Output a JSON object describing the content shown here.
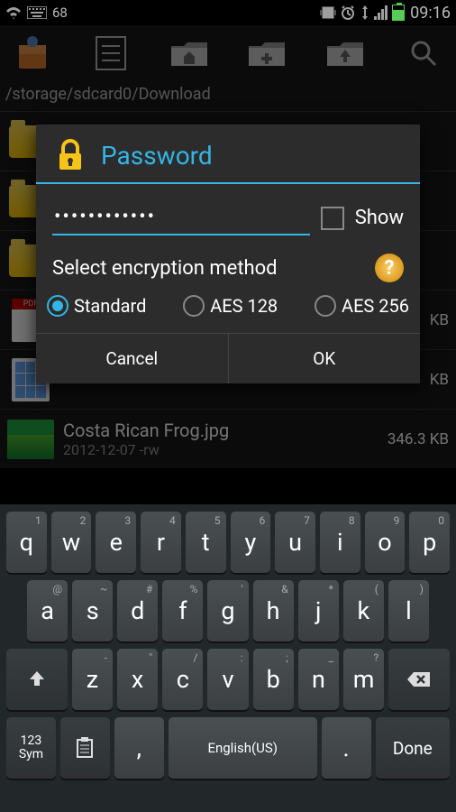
{
  "status": {
    "battery_text": "68",
    "clock": "09:16"
  },
  "breadcrumb": "/storage/sdcard0/Download",
  "files": [
    {
      "name": "",
      "meta": "",
      "size": "",
      "type": "folder"
    },
    {
      "name": "",
      "meta": "",
      "size": "",
      "type": "folder"
    },
    {
      "name": "",
      "meta": "",
      "size": "",
      "type": "folder"
    },
    {
      "name": "",
      "meta": "",
      "size": "KB",
      "type": "pdf"
    },
    {
      "name": "",
      "meta": "",
      "size": "KB",
      "type": "sheet"
    },
    {
      "name": "Costa Rican Frog.jpg",
      "meta": "2012-12-07 -rw",
      "size": "346.3 KB",
      "type": "image"
    }
  ],
  "dialog": {
    "title": "Password",
    "password_value": "••••••••••••",
    "show_label": "Show",
    "encrypt_label": "Select encryption method",
    "options": [
      "Standard",
      "AES 128",
      "AES 256"
    ],
    "selected_option": 0,
    "cancel": "Cancel",
    "ok": "OK"
  },
  "keyboard": {
    "row1": [
      {
        "k": "q",
        "a": "1"
      },
      {
        "k": "w",
        "a": "2"
      },
      {
        "k": "e",
        "a": "3"
      },
      {
        "k": "r",
        "a": "4"
      },
      {
        "k": "t",
        "a": "5"
      },
      {
        "k": "y",
        "a": "6"
      },
      {
        "k": "u",
        "a": "7"
      },
      {
        "k": "i",
        "a": "8"
      },
      {
        "k": "o",
        "a": "9"
      },
      {
        "k": "p",
        "a": "0"
      }
    ],
    "row2": [
      {
        "k": "a",
        "a": "@"
      },
      {
        "k": "s",
        "a": "~"
      },
      {
        "k": "d",
        "a": "#"
      },
      {
        "k": "f",
        "a": "%"
      },
      {
        "k": "g",
        "a": "'"
      },
      {
        "k": "h",
        "a": "&"
      },
      {
        "k": "j",
        "a": "*"
      },
      {
        "k": "k",
        "a": "("
      },
      {
        "k": "l",
        "a": ")"
      }
    ],
    "row3": [
      {
        "k": "z",
        "a": "-"
      },
      {
        "k": "x",
        "a": "\""
      },
      {
        "k": "c",
        "a": "/"
      },
      {
        "k": "v",
        "a": ":"
      },
      {
        "k": "b",
        "a": ";"
      },
      {
        "k": "n",
        "a": "_"
      },
      {
        "k": "m",
        "a": "?"
      }
    ],
    "sym_label": "123\nSym",
    "space_label": "English(US)",
    "done_label": "Done",
    "comma": ",",
    "period": "."
  }
}
